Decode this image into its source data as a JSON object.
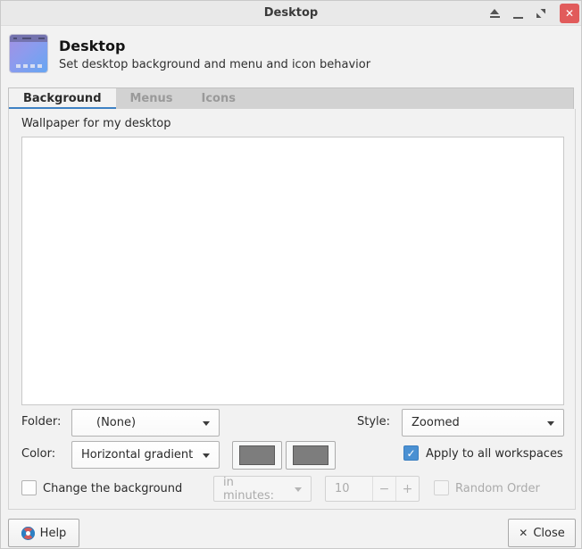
{
  "window": {
    "title": "Desktop"
  },
  "titlebar": {
    "close_glyph": "✕"
  },
  "header": {
    "title": "Desktop",
    "subtitle": "Set desktop background and menu and icon behavior"
  },
  "tabs": [
    {
      "label": "Background",
      "active": true
    },
    {
      "label": "Menus",
      "active": false
    },
    {
      "label": "Icons",
      "active": false
    }
  ],
  "background_tab": {
    "wallpaper_label": "Wallpaper for my desktop",
    "folder_label": "Folder:",
    "folder_value": "(None)",
    "style_label": "Style:",
    "style_value": "Zoomed",
    "color_label": "Color:",
    "color_value": "Horizontal gradient",
    "apply_all_label": "Apply to all workspaces",
    "apply_all_checked": true,
    "check_glyph": "✓",
    "change_bg_label": "Change the background",
    "change_bg_checked": false,
    "interval_unit_value": "in minutes:",
    "interval_value": "10",
    "minus_glyph": "−",
    "plus_glyph": "+",
    "random_order_label": "Random Order",
    "random_order_checked": false
  },
  "footer": {
    "help_label": "Help",
    "close_label": "Close",
    "close_glyph": "✕"
  },
  "colors": {
    "accent_blue": "#3e82c4",
    "titlebar_close_red": "#e15b5b",
    "checkbox_checked_blue": "#4a90d2",
    "swatch_gray": "#7d7d7d"
  }
}
